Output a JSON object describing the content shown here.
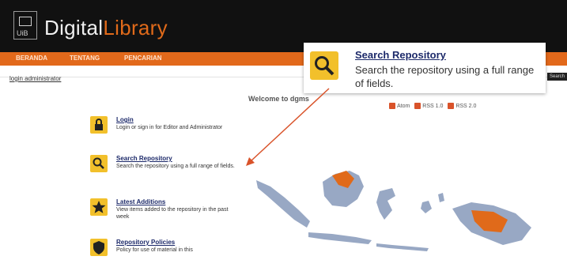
{
  "header": {
    "brand_main": "Digital",
    "brand_accent": "Library"
  },
  "nav": [
    {
      "label": "BERANDA"
    },
    {
      "label": "TENTANG"
    },
    {
      "label": "PENCARIAN"
    }
  ],
  "login_link": "login administrator",
  "search_mini_label": "Search",
  "welcome": "Welcome to dgms",
  "feeds": [
    {
      "label": "Atom"
    },
    {
      "label": "RSS 1.0"
    },
    {
      "label": "RSS 2.0"
    }
  ],
  "callout": {
    "title": "Search Repository",
    "description": "Search the repository using a full range of fields."
  },
  "items": [
    {
      "title": "Login",
      "description": "Login or sign in for Editor and Administrator"
    },
    {
      "title": "Search Repository",
      "description": "Search the repository using a full range of fields."
    },
    {
      "title": "Latest Additions",
      "description": "View items added to the repository in the past week"
    },
    {
      "title": "Repository Policies",
      "description": "Policy for use of material in this"
    }
  ],
  "colors": {
    "header_bg": "#111111",
    "nav_bg": "#e2691b",
    "accent": "#e06a1a",
    "icon_bg": "#f2c02b",
    "arrow": "#d9532a",
    "map_islands": "#98a8c4",
    "map_highlight": "#e06a1a"
  },
  "icons": {
    "login": "lock-icon",
    "search": "magnifier-icon",
    "latest": "star-icon",
    "policies": "shield-icon",
    "feed": "feed-icon"
  }
}
